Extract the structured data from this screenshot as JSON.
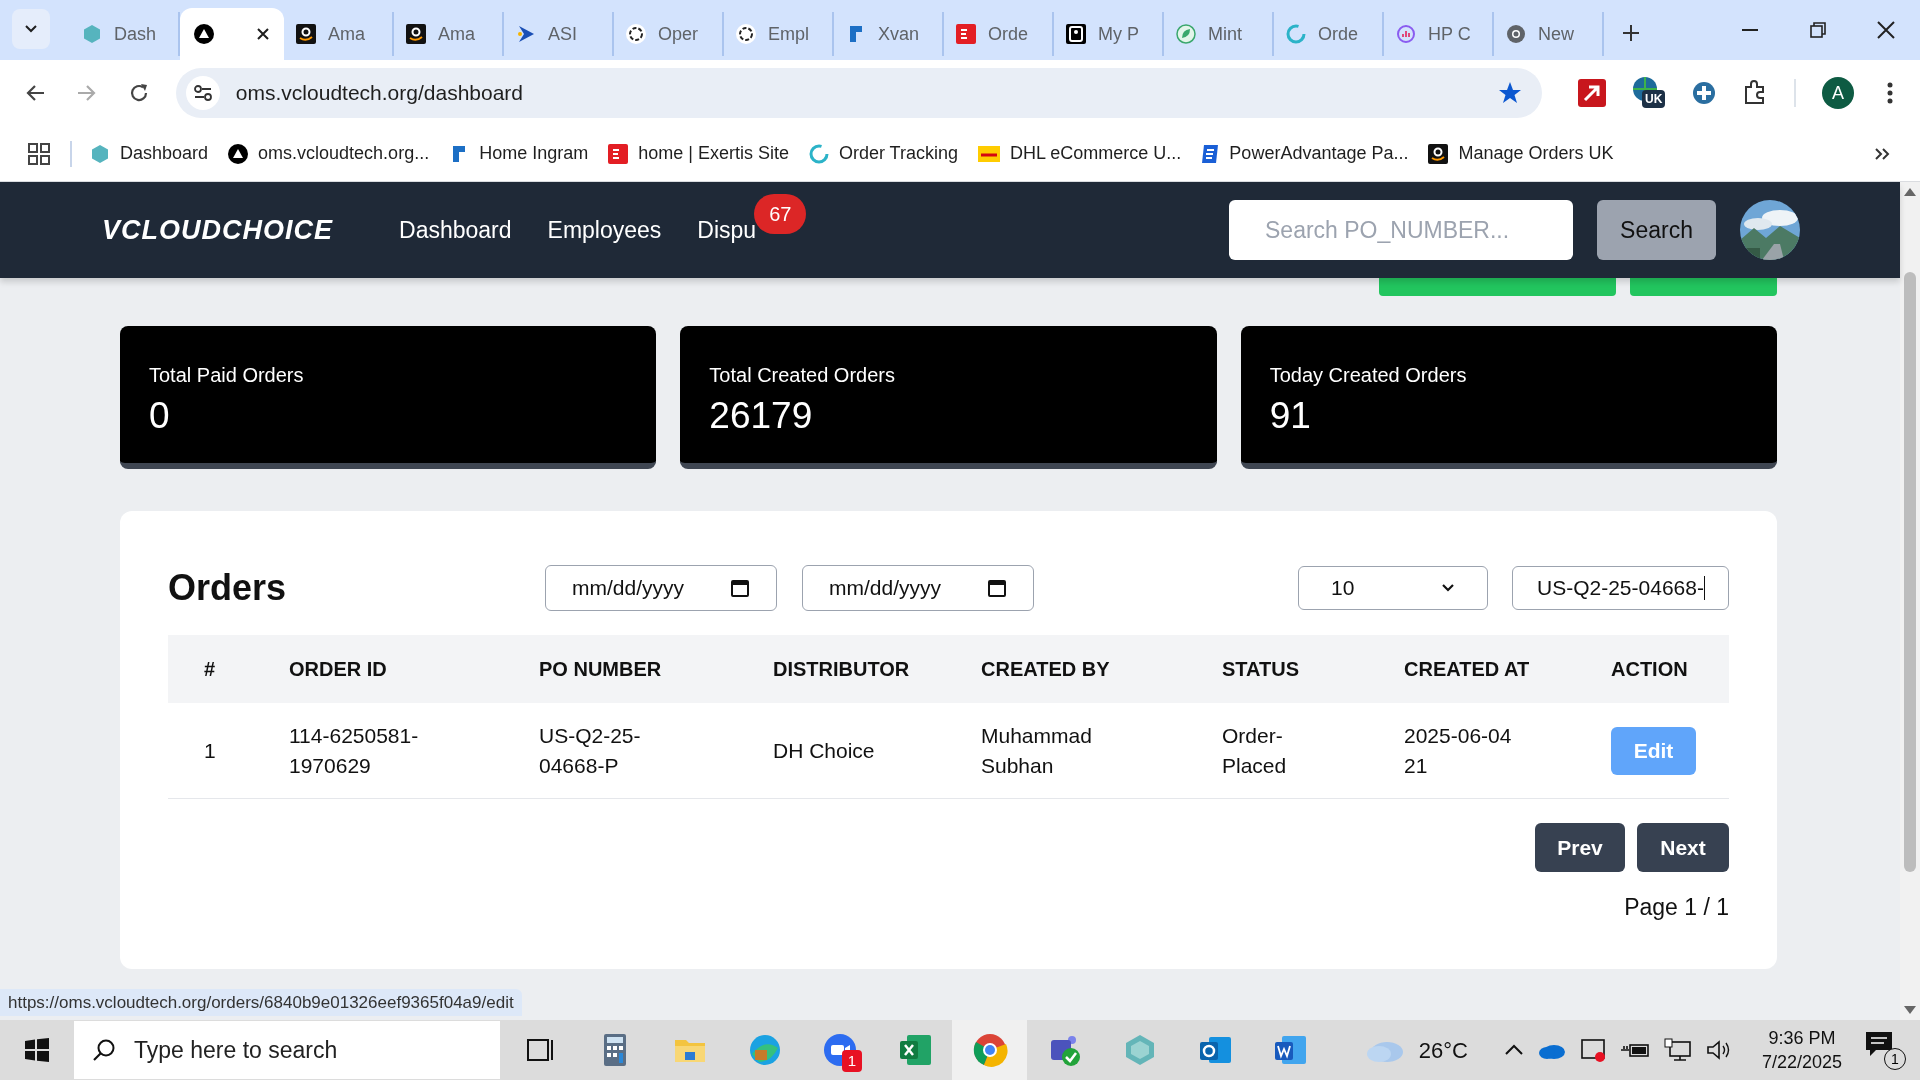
{
  "browser": {
    "tabs": [
      {
        "label": "Dash",
        "selected": false
      },
      {
        "selected": true
      },
      {
        "label": "Ama",
        "selected": false
      },
      {
        "label": "Ama",
        "selected": false
      },
      {
        "label": "ASI",
        "selected": false
      },
      {
        "label": "Oper",
        "selected": false
      },
      {
        "label": "Empl",
        "selected": false
      },
      {
        "label": "Xvan",
        "selected": false
      },
      {
        "label": "Orde",
        "selected": false
      },
      {
        "label": "My P",
        "selected": false
      },
      {
        "label": "Mint",
        "selected": false
      },
      {
        "label": "Orde",
        "selected": false
      },
      {
        "label": "HP C",
        "selected": false
      },
      {
        "label": "New",
        "selected": false
      }
    ],
    "address": "oms.vcloudtech.org/dashboard",
    "profile_initial": "A",
    "extension_badge": "UK",
    "bookmarks": [
      "Dashboard",
      "oms.vcloudtech.org...",
      "Home Ingram",
      "home | Exertis Site",
      "Order Tracking",
      "DHL eCommerce U...",
      "PowerAdvantage Pa...",
      "Manage Orders UK"
    ],
    "status_url": "https://oms.vcloudtech.org/orders/6840b9e01326eef9365f04a9/edit"
  },
  "app": {
    "logo": "VCLOUDCHOICE",
    "nav": [
      {
        "label": "Dashboard"
      },
      {
        "label": "Employees"
      },
      {
        "label": "Dispu",
        "badge": "67"
      }
    ],
    "search": {
      "placeholder": "Search PO_NUMBER...",
      "button": "Search"
    },
    "stats": [
      {
        "label": "Total Paid Orders",
        "value": "0"
      },
      {
        "label": "Total Created Orders",
        "value": "26179"
      },
      {
        "label": "Today Created Orders",
        "value": "91"
      }
    ],
    "orders": {
      "title": "Orders",
      "date_from": {
        "placeholder": "mm/dd/yyyy"
      },
      "date_to": {
        "placeholder": "mm/dd/yyyy"
      },
      "page_size": "10",
      "search_value": "US-Q2-25-04668-",
      "columns": [
        "#",
        "ORDER ID",
        "PO NUMBER",
        "DISTRIBUTOR",
        "CREATED BY",
        "STATUS",
        "CREATED AT",
        "ACTION"
      ],
      "rows": [
        {
          "index": "1",
          "order_id": "114-6250581-1970629",
          "po_number": "US-Q2-25-04668-P",
          "distributor": "DH Choice",
          "created_by": "Muhammad Subhan",
          "status": "Order-Placed",
          "created_at": "2025-06-04 21",
          "action": "Edit"
        }
      ],
      "prev": "Prev",
      "next": "Next",
      "page": "Page 1 / 1"
    }
  },
  "taskbar": {
    "search_placeholder": "Type here to search",
    "zoom_badge": "1",
    "temperature": "26°C",
    "time": "9:36 PM",
    "date": "7/22/2025",
    "notifications": "1"
  }
}
